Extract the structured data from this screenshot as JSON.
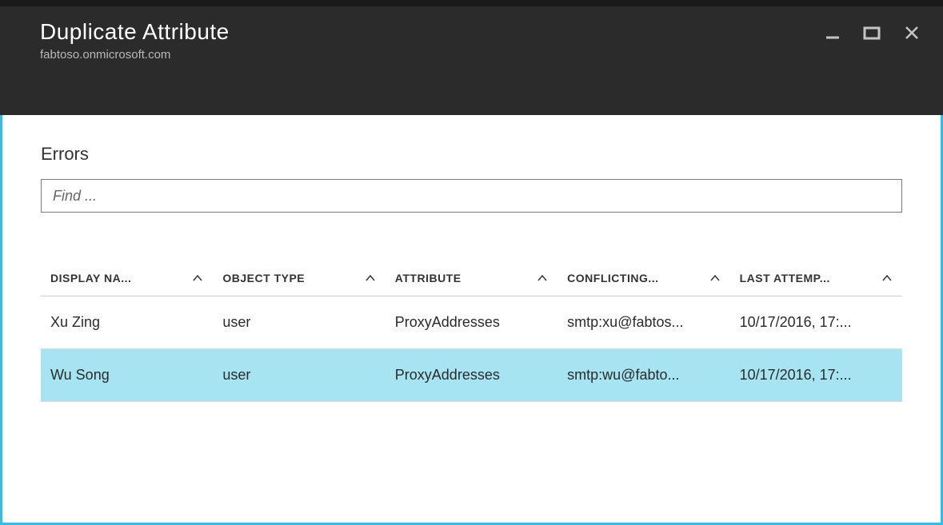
{
  "header": {
    "title": "Duplicate Attribute",
    "subtitle": "fabtoso.onmicrosoft.com"
  },
  "section": {
    "title": "Errors"
  },
  "search": {
    "placeholder": "Find ..."
  },
  "table": {
    "columns": {
      "display_name": "DISPLAY NA...",
      "object_type": "OBJECT TYPE",
      "attribute": "ATTRIBUTE",
      "conflicting": "CONFLICTING...",
      "last_attempt": "LAST ATTEMP..."
    },
    "rows": [
      {
        "display_name": "Xu Zing",
        "object_type": "user",
        "attribute": "ProxyAddresses",
        "conflicting": "smtp:xu@fabtos...",
        "last_attempt": "10/17/2016, 17:..."
      },
      {
        "display_name": "Wu Song",
        "object_type": "user",
        "attribute": "ProxyAddresses",
        "conflicting": "smtp:wu@fabto...",
        "last_attempt": "10/17/2016, 17:..."
      }
    ],
    "selected_index": 1
  }
}
